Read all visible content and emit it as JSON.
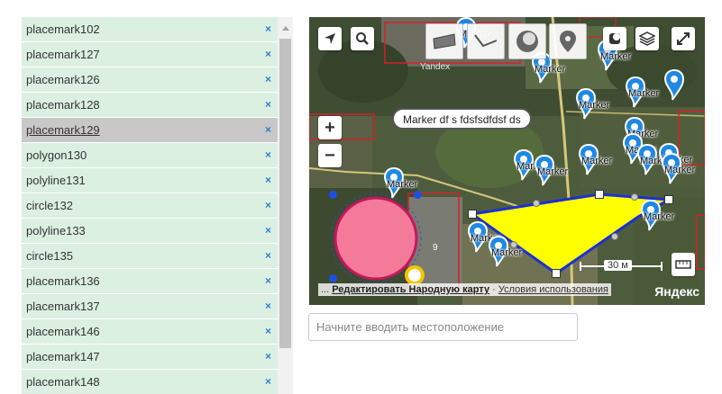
{
  "list": {
    "items": [
      {
        "label": "placemark102",
        "remove": "×",
        "selected": false
      },
      {
        "label": "placemark127",
        "remove": "×",
        "selected": false
      },
      {
        "label": "placemark126",
        "remove": "×",
        "selected": false
      },
      {
        "label": "placemark128",
        "remove": "×",
        "selected": false
      },
      {
        "label": "placemark129",
        "remove": "×",
        "selected": true
      },
      {
        "label": "polygon130",
        "remove": "×",
        "selected": false
      },
      {
        "label": "polyline131",
        "remove": "×",
        "selected": false
      },
      {
        "label": "circle132",
        "remove": "×",
        "selected": false
      },
      {
        "label": "polyline133",
        "remove": "×",
        "selected": false
      },
      {
        "label": "circle135",
        "remove": "×",
        "selected": false
      },
      {
        "label": "placemark136",
        "remove": "×",
        "selected": false
      },
      {
        "label": "placemark137",
        "remove": "×",
        "selected": false
      },
      {
        "label": "placemark146",
        "remove": "×",
        "selected": false
      },
      {
        "label": "placemark147",
        "remove": "×",
        "selected": false
      },
      {
        "label": "placemark148",
        "remove": "×",
        "selected": false
      }
    ]
  },
  "map": {
    "marker_label": "Marker",
    "balloon_text": "Marker df s fdsfsdfdsf ds",
    "zoom_in": "+",
    "zoom_out": "−",
    "scale_text": "30 м",
    "copyright_prefix": "...",
    "copyright_edit": "Редактировать Народную карту",
    "copyright_sep": "·",
    "copyright_terms": "Условия использования",
    "logo": "Яндекс",
    "watermark": "Yandex",
    "house_number": "9",
    "polygon_color": "#ffff00",
    "polygon_stroke": "#1c2fd6",
    "circle_color": "#f47a9a",
    "marker_color": "#1e88e5",
    "icons": {
      "geolocation": "navigation-arrow-icon",
      "search": "magnifier-icon",
      "draw_polygon": "polygon-icon",
      "draw_polyline": "polyline-icon",
      "draw_circle": "circle-icon",
      "draw_placemark": "placemark-icon",
      "traffic": "traffic-icon",
      "layers": "layers-icon",
      "fullscreen": "fullscreen-icon",
      "ruler": "ruler-icon"
    }
  },
  "search": {
    "placeholder": "Начните вводить местоположение",
    "value": ""
  }
}
